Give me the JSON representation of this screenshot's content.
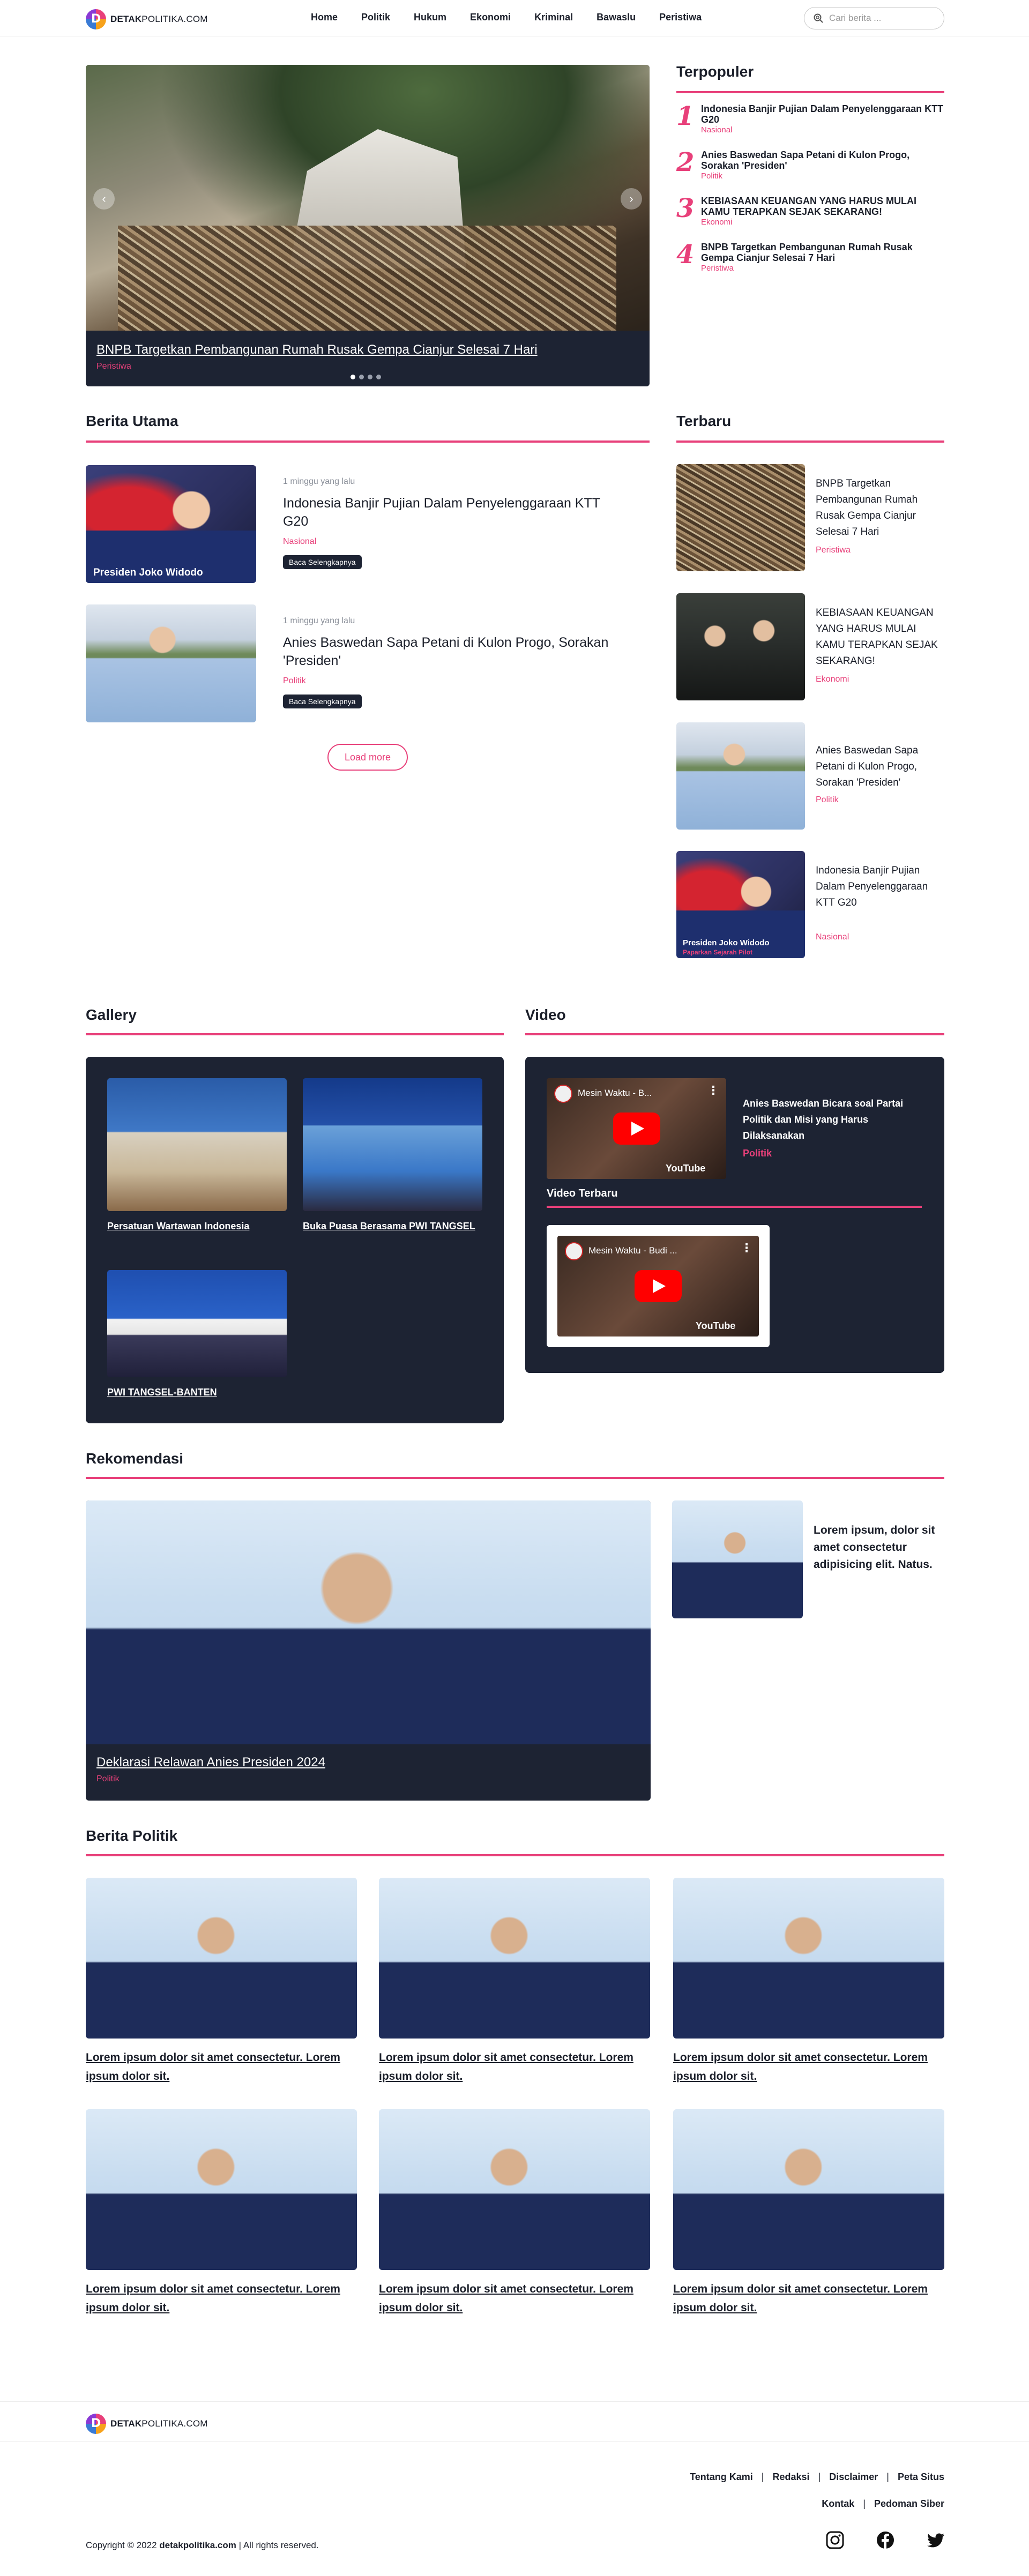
{
  "brand": {
    "name_bold": "DETAK",
    "name_thin": "POLITIKA.COM"
  },
  "nav": [
    "Home",
    "Politik",
    "Hukum",
    "Ekonomi",
    "Kriminal",
    "Bawaslu",
    "Peristiwa"
  ],
  "search": {
    "placeholder": "Cari berita ..."
  },
  "hero": {
    "title": "BNPB Targetkan Pembangunan Rumah Rusak Gempa Cianjur Selesai 7 Hari",
    "category": "Peristiwa",
    "slide_count": 4,
    "active_slide": 1
  },
  "terpopuler": {
    "heading": "Terpopuler",
    "items": [
      {
        "num": "1",
        "title": "Indonesia Banjir Pujian Dalam Penyelenggaraan KTT G20",
        "category": "Nasional"
      },
      {
        "num": "2",
        "title": "Anies Baswedan Sapa Petani di Kulon Progo, Sorakan 'Presiden'",
        "category": "Politik"
      },
      {
        "num": "3",
        "title": "KEBIASAAN KEUANGAN YANG HARUS MULAI KAMU TERAPKAN SEJAK SEKARANG!",
        "category": "Ekonomi"
      },
      {
        "num": "4",
        "title": "BNPB Targetkan Pembangunan Rumah Rusak Gempa Cianjur Selesai 7 Hari",
        "category": "Peristiwa"
      }
    ]
  },
  "berita_utama": {
    "heading": "Berita Utama",
    "items": [
      {
        "time": "1 minggu yang lalu",
        "title": "Indonesia Banjir Pujian Dalam Penyelenggaraan KTT G20",
        "category": "Nasional",
        "button": "Baca Selengkapnya",
        "image_caption": "Presiden Joko Widodo"
      },
      {
        "time": "1 minggu yang lalu",
        "title": "Anies Baswedan Sapa Petani di Kulon Progo, Sorakan 'Presiden'",
        "category": "Politik",
        "button": "Baca Selengkapnya"
      }
    ],
    "load_more": "Load more"
  },
  "terbaru": {
    "heading": "Terbaru",
    "items": [
      {
        "title": "BNPB Targetkan Pembangunan Rumah Rusak Gempa Cianjur Selesai 7 Hari",
        "category": "Peristiwa"
      },
      {
        "title": "KEBIASAAN KEUANGAN YANG HARUS MULAI KAMU TERAPKAN SEJAK SEKARANG!",
        "category": "Ekonomi"
      },
      {
        "title": "Anies Baswedan Sapa Petani di Kulon Progo, Sorakan 'Presiden'",
        "category": "Politik"
      },
      {
        "title": "Indonesia Banjir Pujian Dalam Penyelenggaraan KTT G20",
        "category": "Nasional",
        "image_caption": "Presiden Joko Widodo",
        "image_subcaption": "Paparkan Sejarah Pilot"
      }
    ]
  },
  "gallery": {
    "heading": "Gallery",
    "items": [
      {
        "caption": "Persatuan Wartawan Indonesia"
      },
      {
        "caption": "Buka Puasa Berasama PWI TANGSEL"
      },
      {
        "caption": "PWI TANGSEL-BANTEN"
      }
    ]
  },
  "video": {
    "heading": "Video",
    "featured": {
      "player_title": "Mesin Waktu - B...",
      "title": "Anies Baswedan Bicara soal Partai Politik dan Misi yang Harus Dilaksanakan",
      "category": "Politik"
    },
    "latest_heading": "Video Terbaru",
    "latest": {
      "player_title": "Mesin Waktu - Budi ..."
    },
    "yt_label": "YouTube"
  },
  "rekomendasi": {
    "heading": "Rekomendasi",
    "main": {
      "title": "Deklarasi Relawan Anies Presiden 2024",
      "category": "Politik"
    },
    "side": {
      "text": "Lorem ipsum, dolor sit amet consectetur adipisicing elit. Natus."
    }
  },
  "berita_politik": {
    "heading": "Berita Politik",
    "items": [
      {
        "title": "Lorem ipsum dolor sit amet consectetur. Lorem ipsum dolor sit."
      },
      {
        "title": "Lorem ipsum dolor sit amet consectetur. Lorem ipsum dolor sit."
      },
      {
        "title": "Lorem ipsum dolor sit amet consectetur. Lorem ipsum dolor sit."
      },
      {
        "title": "Lorem ipsum dolor sit amet consectetur. Lorem ipsum dolor sit."
      },
      {
        "title": "Lorem ipsum dolor sit amet consectetur. Lorem ipsum dolor sit."
      },
      {
        "title": "Lorem ipsum dolor sit amet consectetur. Lorem ipsum dolor sit."
      }
    ]
  },
  "footer": {
    "links_row1": [
      "Tentang Kami",
      "Redaksi",
      "Disclaimer",
      "Peta Situs"
    ],
    "links_row2": [
      "Kontak",
      "Pedoman Siber"
    ],
    "copyright_pre": "Copyright © 2022 ",
    "copyright_site": "detakpolitika.com",
    "copyright_post": " | All rights reserved.",
    "socials": [
      "instagram-icon",
      "facebook-icon",
      "twitter-icon"
    ]
  },
  "colors": {
    "accent": "#e8407a",
    "dark": "#1d2333"
  }
}
